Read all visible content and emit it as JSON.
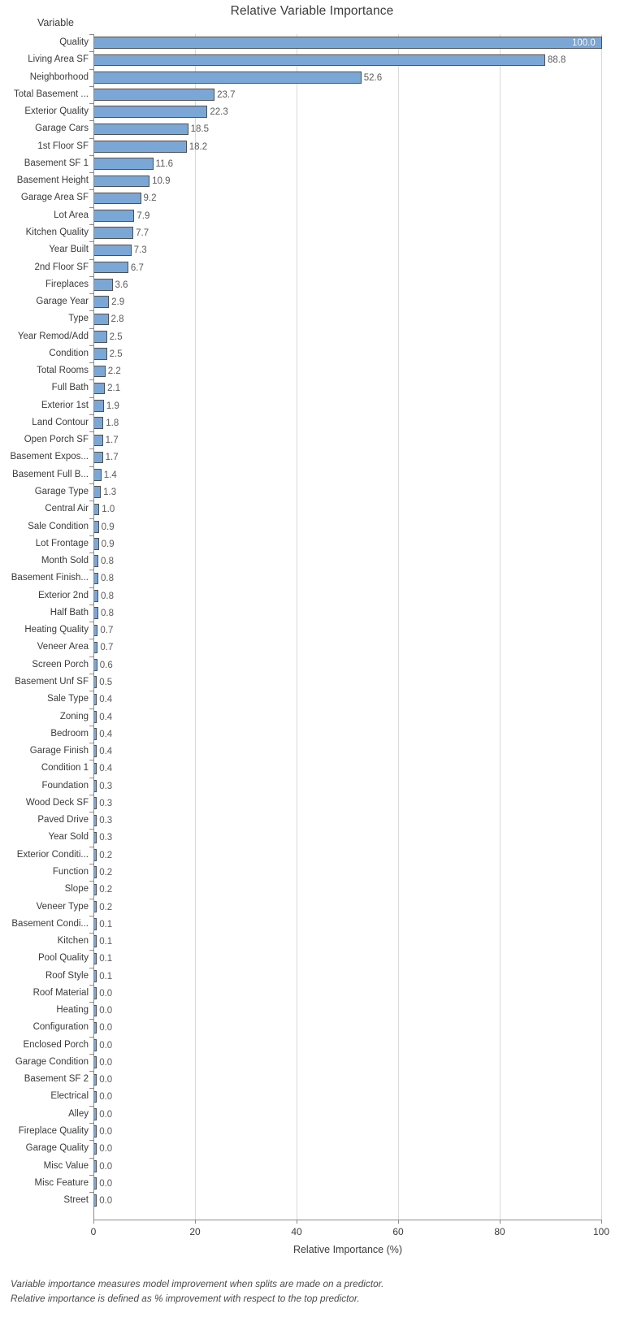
{
  "chart_data": {
    "type": "bar",
    "orientation": "horizontal",
    "title": "Relative Variable Importance",
    "xlabel": "Relative Importance (%)",
    "ylabel": "Variable",
    "xlim": [
      0,
      100
    ],
    "xticks": [
      0,
      20,
      40,
      60,
      80,
      100
    ],
    "xtick_labels": [
      "0",
      "20",
      "40",
      "60",
      "80",
      "100"
    ],
    "grid": "vertical",
    "legend": "none",
    "bar_color": "#7ba7d7",
    "bar_border_color": "#4f4f4f",
    "axis_color": "#8c8c8c",
    "gridline_color": "#d9d9d9",
    "categories": [
      "Quality",
      "Living Area SF",
      "Neighborhood",
      "Total Basement ...",
      "Exterior Quality",
      "Garage Cars",
      "1st Floor SF",
      "Basement SF 1",
      "Basement Height",
      "Garage Area SF",
      "Lot Area",
      "Kitchen Quality",
      "Year Built",
      "2nd Floor SF",
      "Fireplaces",
      "Garage Year",
      "Type",
      "Year Remod/Add",
      "Condition",
      "Total Rooms",
      "Full Bath",
      "Exterior 1st",
      "Land Contour",
      "Open Porch SF",
      "Basement Expos...",
      "Basement Full B...",
      "Garage Type",
      "Central Air",
      "Sale Condition",
      "Lot Frontage",
      "Month Sold",
      "Basement Finish...",
      "Exterior 2nd",
      "Half Bath",
      "Heating Quality",
      "Veneer Area",
      "Screen Porch",
      "Basement Unf SF",
      "Sale Type",
      "Zoning",
      "Bedroom",
      "Garage Finish",
      "Condition 1",
      "Foundation",
      "Wood Deck SF",
      "Paved Drive",
      "Year Sold",
      "Exterior Conditi...",
      "Function",
      "Slope",
      "Veneer Type",
      "Basement Condi...",
      "Kitchen",
      "Pool Quality",
      "Roof Style",
      "Roof Material",
      "Heating",
      "Configuration",
      "Enclosed Porch",
      "Garage Condition",
      "Basement SF 2",
      "Electrical",
      "Alley",
      "Fireplace Quality",
      "Garage Quality",
      "Misc Value",
      "Misc Feature",
      "Street"
    ],
    "values": [
      100.0,
      88.8,
      52.6,
      23.7,
      22.3,
      18.5,
      18.2,
      11.6,
      10.9,
      9.2,
      7.9,
      7.7,
      7.3,
      6.7,
      3.6,
      2.9,
      2.8,
      2.5,
      2.5,
      2.2,
      2.1,
      1.9,
      1.8,
      1.7,
      1.7,
      1.4,
      1.3,
      1.0,
      0.9,
      0.9,
      0.8,
      0.8,
      0.8,
      0.8,
      0.7,
      0.7,
      0.6,
      0.5,
      0.4,
      0.4,
      0.4,
      0.4,
      0.4,
      0.3,
      0.3,
      0.3,
      0.3,
      0.2,
      0.2,
      0.2,
      0.2,
      0.1,
      0.1,
      0.1,
      0.1,
      0.0,
      0.0,
      0.0,
      0.0,
      0.0,
      0.0,
      0.0,
      0.0,
      0.0,
      0.0,
      0.0,
      0.0,
      0.0
    ],
    "value_labels": [
      "100.0",
      "88.8",
      "52.6",
      "23.7",
      "22.3",
      "18.5",
      "18.2",
      "11.6",
      "10.9",
      "9.2",
      "7.9",
      "7.7",
      "7.3",
      "6.7",
      "3.6",
      "2.9",
      "2.8",
      "2.5",
      "2.5",
      "2.2",
      "2.1",
      "1.9",
      "1.8",
      "1.7",
      "1.7",
      "1.4",
      "1.3",
      "1.0",
      "0.9",
      "0.9",
      "0.8",
      "0.8",
      "0.8",
      "0.8",
      "0.7",
      "0.7",
      "0.6",
      "0.5",
      "0.4",
      "0.4",
      "0.4",
      "0.4",
      "0.4",
      "0.3",
      "0.3",
      "0.3",
      "0.3",
      "0.2",
      "0.2",
      "0.2",
      "0.2",
      "0.1",
      "0.1",
      "0.1",
      "0.1",
      "0.0",
      "0.0",
      "0.0",
      "0.0",
      "0.0",
      "0.0",
      "0.0",
      "0.0",
      "0.0",
      "0.0",
      "0.0",
      "0.0",
      "0.0"
    ]
  },
  "footnote": {
    "line1": "Variable importance measures model improvement when splits are made on a predictor.",
    "line2": "Relative importance is defined as % improvement with respect to the top predictor."
  }
}
